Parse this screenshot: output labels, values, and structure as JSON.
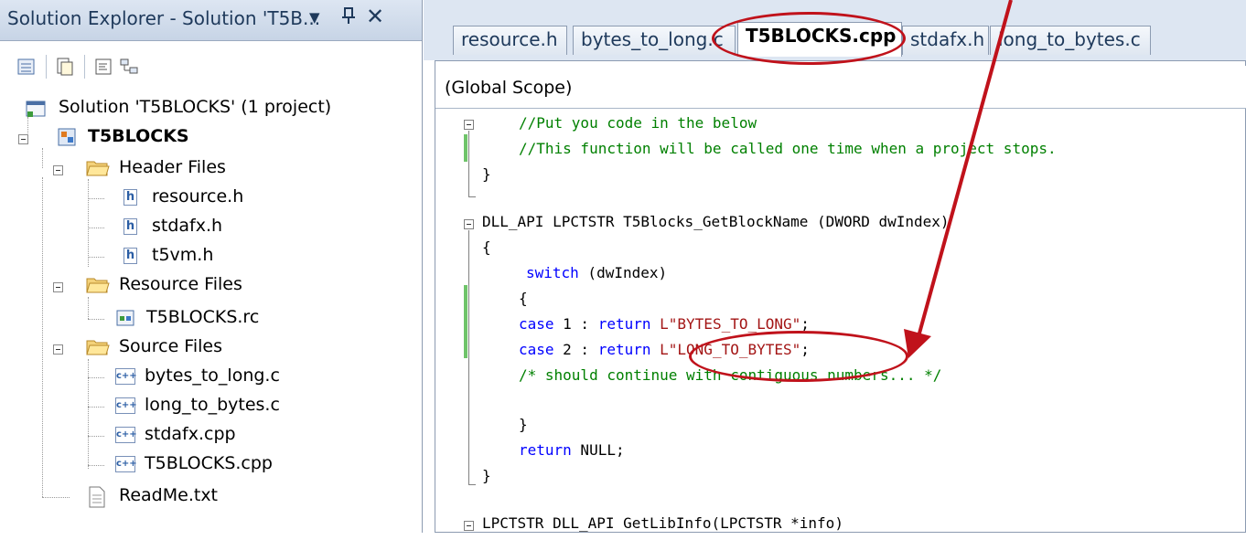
{
  "solution_explorer": {
    "title": "Solution Explorer - Solution 'T5B...",
    "dropdown_glyph": "▼",
    "pin_glyph": "ꟷ",
    "close_glyph": "✕",
    "toolbar_icons": [
      "properties-icon",
      "show-all-files-icon",
      "view-code-icon",
      "class-diagram-icon"
    ],
    "tree": {
      "solution": "Solution 'T5BLOCKS' (1 project)",
      "project": "T5BLOCKS",
      "header_folder": "Header Files",
      "header_files": [
        "resource.h",
        "stdafx.h",
        "t5vm.h"
      ],
      "resource_folder": "Resource Files",
      "resource_files": [
        "T5BLOCKS.rc"
      ],
      "source_folder": "Source Files",
      "source_files": [
        "bytes_to_long.c",
        "long_to_bytes.c",
        "stdafx.cpp",
        "T5BLOCKS.cpp"
      ],
      "readme": "ReadMe.txt"
    }
  },
  "editor": {
    "tabs": [
      "resource.h",
      "bytes_to_long.c",
      "T5BLOCKS.cpp",
      "stdafx.h",
      "long_to_bytes.c"
    ],
    "active_tab": "T5BLOCKS.cpp",
    "scope": "(Global Scope)",
    "code": {
      "l1": "//Put you code in the below",
      "l2": "//This function will be called one time when a project stops.",
      "l3": "}",
      "l5a": "DLL_API LPCTSTR T5Blocks_GetBlockName (DWORD dwIndex)",
      "l6": "{",
      "l7_kw": "switch",
      "l7_rest": " (dwIndex)",
      "l8": "{",
      "case1_kw": "case",
      "case1_mid": " 1 : ",
      "case1_ret": "return",
      "case1_str": "L\"BYTES_TO_LONG\"",
      "case1_end": ";",
      "case2_kw": "case",
      "case2_mid": " 2 : ",
      "case2_ret": "return",
      "case2_str": "L\"LONG_TO_BYTES\"",
      "case2_end": ";",
      "comment": "/* should continue with contiguous numbers... */",
      "close_inner": "}",
      "ret_kw": "return",
      "ret_rest": " NULL;",
      "close_outer": "}",
      "last": "LPCTSTR DLL_API GetLibInfo(LPCTSTR *info)"
    }
  },
  "colors": {
    "annotation": "#c0121b",
    "keyword": "#0000ff",
    "comment": "#008000",
    "string": "#a31515",
    "change_marker": "#6fc46a"
  }
}
